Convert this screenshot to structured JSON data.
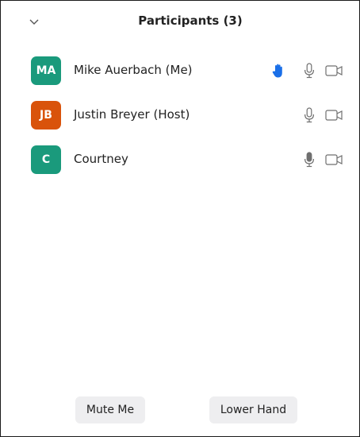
{
  "header": {
    "title": "Participants (3)",
    "collapse_icon": "chevron-down-icon"
  },
  "participants": [
    {
      "initials": "MA",
      "name": "Mike Auerbach (Me)",
      "avatar_color": "#1a9a7c",
      "hand_raised": true,
      "mic_state": "unmuted",
      "camera_state": "off"
    },
    {
      "initials": "JB",
      "name": "Justin Breyer (Host)",
      "avatar_color": "#d9530b",
      "hand_raised": false,
      "mic_state": "unmuted",
      "camera_state": "off"
    },
    {
      "initials": "C",
      "name": "Courtney",
      "avatar_color": "#1a9a7c",
      "hand_raised": false,
      "mic_state": "speaking",
      "camera_state": "off"
    }
  ],
  "footer": {
    "mute_label": "Mute Me",
    "lower_hand_label": "Lower Hand"
  },
  "colors": {
    "hand_blue": "#1a6fe8",
    "icon_gray": "#6f6f6f"
  }
}
